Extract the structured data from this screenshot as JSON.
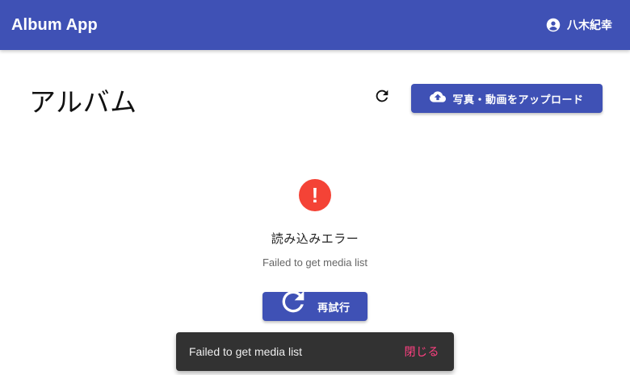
{
  "appbar": {
    "title": "Album App",
    "user_name": "八木紀幸",
    "user_icon": "account-circle-icon"
  },
  "page": {
    "title": "アルバム"
  },
  "toolbar": {
    "refresh_icon": "refresh-icon",
    "upload_label": "写真・動画をアップロード",
    "upload_icon": "cloud-upload-icon"
  },
  "error": {
    "icon": "error-icon",
    "symbol": "!",
    "title": "読み込みエラー",
    "message": "Failed to get media list",
    "retry_label": "再試行",
    "retry_icon": "refresh-icon"
  },
  "snackbar": {
    "message": "Failed to get media list",
    "action_label": "閉じる"
  },
  "colors": {
    "primary": "#3f51b5",
    "error": "#f44336",
    "snackbar_bg": "#323232",
    "snackbar_action": "#ff4081"
  }
}
